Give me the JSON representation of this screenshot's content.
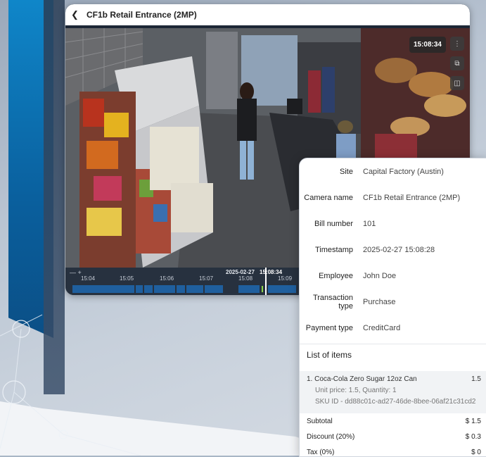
{
  "camera": {
    "title": "CF1b Retail Entrance (2MP)",
    "time_badge": "15:08:34",
    "timeline": {
      "zoom": "—  +",
      "date": "2025-02-27",
      "now": "15:08:34",
      "ticks": [
        "15:04",
        "15:05",
        "15:06",
        "15:07",
        "15:08",
        "15:09"
      ]
    }
  },
  "details": {
    "site_label": "Site",
    "site_value": "Capital Factory (Austin)",
    "camera_label": "Camera name",
    "camera_value": "CF1b Retail Entrance (2MP)",
    "bill_label": "Bill number",
    "bill_value": "101",
    "timestamp_label": "Timestamp",
    "timestamp_value": "2025-02-27 15:08:28",
    "employee_label": "Employee",
    "employee_value": "John Doe",
    "txtype_label": "Transaction type",
    "txtype_value": "Purchase",
    "payment_label": "Payment type",
    "payment_value": "CreditCard",
    "items_title": "List of items",
    "items": [
      {
        "name": "1. Coca-Cola Zero Sugar 12oz Can",
        "amount": "1.5",
        "unit": "Unit price: 1.5, Quantity: 1",
        "sku": "SKU ID - dd88c01c-ad27-46de-8bee-06af21c31cd2"
      }
    ],
    "subtotal_label": "Subtotal",
    "subtotal_value": "$ 1.5",
    "discount_label": "Discount (20%)",
    "discount_value": "$ 0.3",
    "tax_label": "Tax (0%)",
    "tax_value": "$ 0"
  },
  "icons": {
    "back": "chevron-left-icon",
    "more": "more-vertical-icon",
    "popout": "external-link-icon",
    "layout": "layout-icon"
  }
}
